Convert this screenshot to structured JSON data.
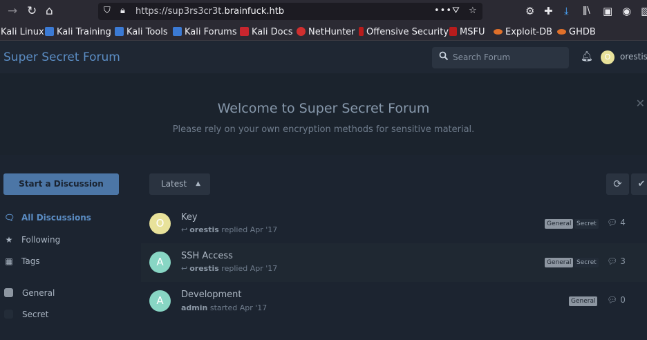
{
  "browser": {
    "url_prefix": "https://sup3rs3cr3t.",
    "url_domain": "brainfuck.htb",
    "page_actions": "•••",
    "bookmarks": [
      {
        "label": "Kali Linux",
        "icon": "kali-dragon-icon"
      },
      {
        "label": "Kali Training",
        "icon": "kali-dragon-icon"
      },
      {
        "label": "Kali Tools",
        "icon": "kali-dragon-icon"
      },
      {
        "label": "Kali Forums",
        "icon": "kali-dragon-icon"
      },
      {
        "label": "Kali Docs",
        "icon": "kali-docs-icon"
      },
      {
        "label": "NetHunter",
        "icon": "nethunter-icon"
      },
      {
        "label": "Offensive Security",
        "icon": "offsec-icon"
      },
      {
        "label": "MSFU",
        "icon": "msfu-icon"
      },
      {
        "label": "Exploit-DB",
        "icon": "exploitdb-icon"
      },
      {
        "label": "GHDB",
        "icon": "ghdb-icon"
      }
    ]
  },
  "forum": {
    "title": "Super Secret Forum",
    "search_placeholder": "Search Forum",
    "user": {
      "name": "orestis",
      "initial": "O",
      "avatar_color": "#e8e29a"
    }
  },
  "hero": {
    "title": "Welcome to Super Secret Forum",
    "subtitle": "Please rely on your own encryption methods for sensitive material."
  },
  "sidebar": {
    "start_button": "Start a Discussion",
    "nav": [
      {
        "label": "All Discussions",
        "icon": "comments-icon",
        "active": true
      },
      {
        "label": "Following",
        "icon": "star-icon",
        "active": false
      },
      {
        "label": "Tags",
        "icon": "tags-grid-icon",
        "active": false
      }
    ],
    "tags": [
      {
        "label": "General",
        "color": "#8d96a1"
      },
      {
        "label": "Secret",
        "color": "#232c38"
      }
    ]
  },
  "toolbar": {
    "sort_label": "Latest"
  },
  "discussions": [
    {
      "title": "Key",
      "initial": "O",
      "avatar_color": "#e8e29a",
      "author": "orestis",
      "action": "replied",
      "date": "Apr '17",
      "replied_icon": true,
      "tags": [
        "General",
        "Secret"
      ],
      "replies": "4"
    },
    {
      "title": "SSH Access",
      "initial": "A",
      "avatar_color": "#88d6c4",
      "author": "orestis",
      "action": "replied",
      "date": "Apr '17",
      "replied_icon": true,
      "tags": [
        "General",
        "Secret"
      ],
      "replies": "3"
    },
    {
      "title": "Development",
      "initial": "A",
      "avatar_color": "#88d6c4",
      "author": "admin",
      "action": "started",
      "date": "Apr '17",
      "replied_icon": false,
      "tags": [
        "General"
      ],
      "replies": "0"
    }
  ]
}
